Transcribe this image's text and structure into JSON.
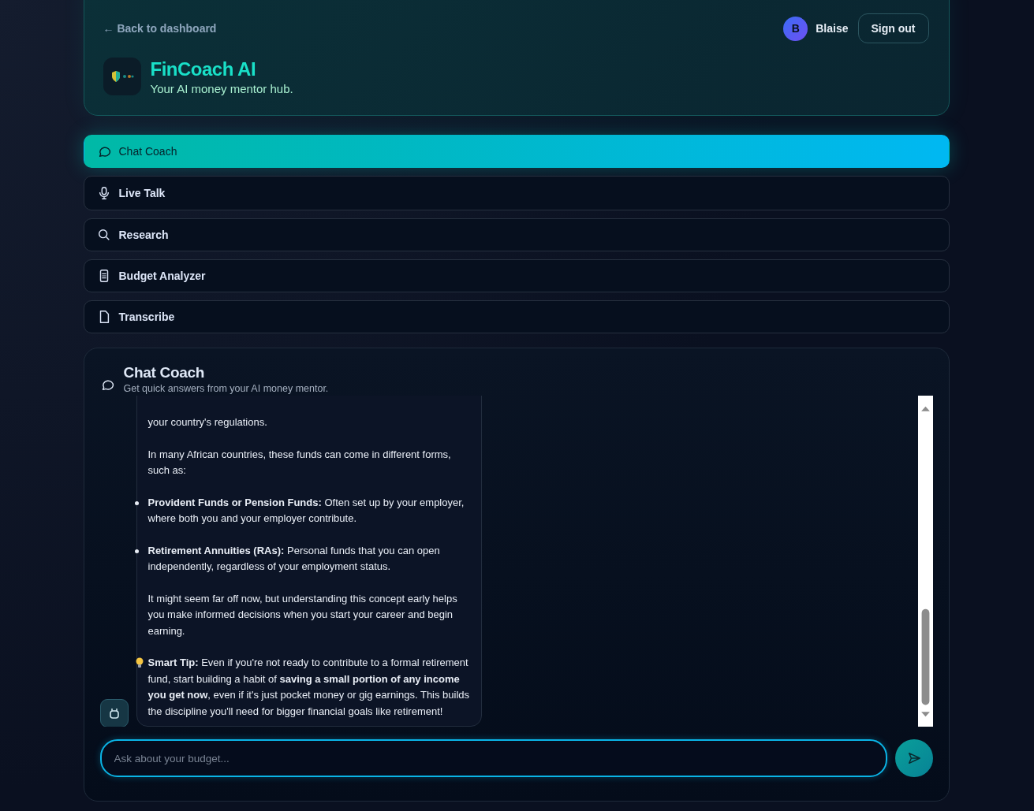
{
  "header": {
    "back_link": "← Back to dashboard",
    "title": "FinCoach AI",
    "subtitle": "Your AI money mentor hub.",
    "user": {
      "initial": "B",
      "name": "Blaise"
    },
    "sign_out": "Sign out"
  },
  "tabs": [
    {
      "label": "Chat Coach",
      "kind": "chat",
      "selected": true
    },
    {
      "label": "Live Talk",
      "kind": "mic",
      "selected": false
    },
    {
      "label": "Research",
      "kind": "search",
      "selected": false
    },
    {
      "label": "Budget Analyzer",
      "kind": "calc",
      "selected": false
    },
    {
      "label": "Transcribe",
      "kind": "file",
      "selected": false
    }
  ],
  "panel": {
    "title": "Chat Coach",
    "subtitle": "Get quick answers from your AI money mentor.",
    "message": [
      {
        "kind": "para",
        "text": "your country's regulations."
      },
      {
        "kind": "para",
        "text": "In many African countries, these funds can come in different forms, such as:"
      },
      {
        "kind": "bullet",
        "text": "**Provident Funds or Pension Funds:** Often set up by your employer, where both you and your employer contribute."
      },
      {
        "kind": "bullet",
        "text": "**Retirement Annuities (RAs):** Personal funds that you can open independently, regardless of your employment status."
      },
      {
        "kind": "para",
        "text": "It might seem far off now, but understanding this concept early helps you make informed decisions when you start your career and begin earning."
      },
      {
        "kind": "tip",
        "text": "**Smart Tip:** Even if you're not ready to contribute to a formal retirement fund, start building a habit of **saving a small portion of any income you get now**, even if it's just pocket money or gig earnings. This builds the discipline you'll need for bigger financial goals like retirement!"
      }
    ],
    "input": {
      "placeholder": "Ask about your budget..."
    }
  }
}
